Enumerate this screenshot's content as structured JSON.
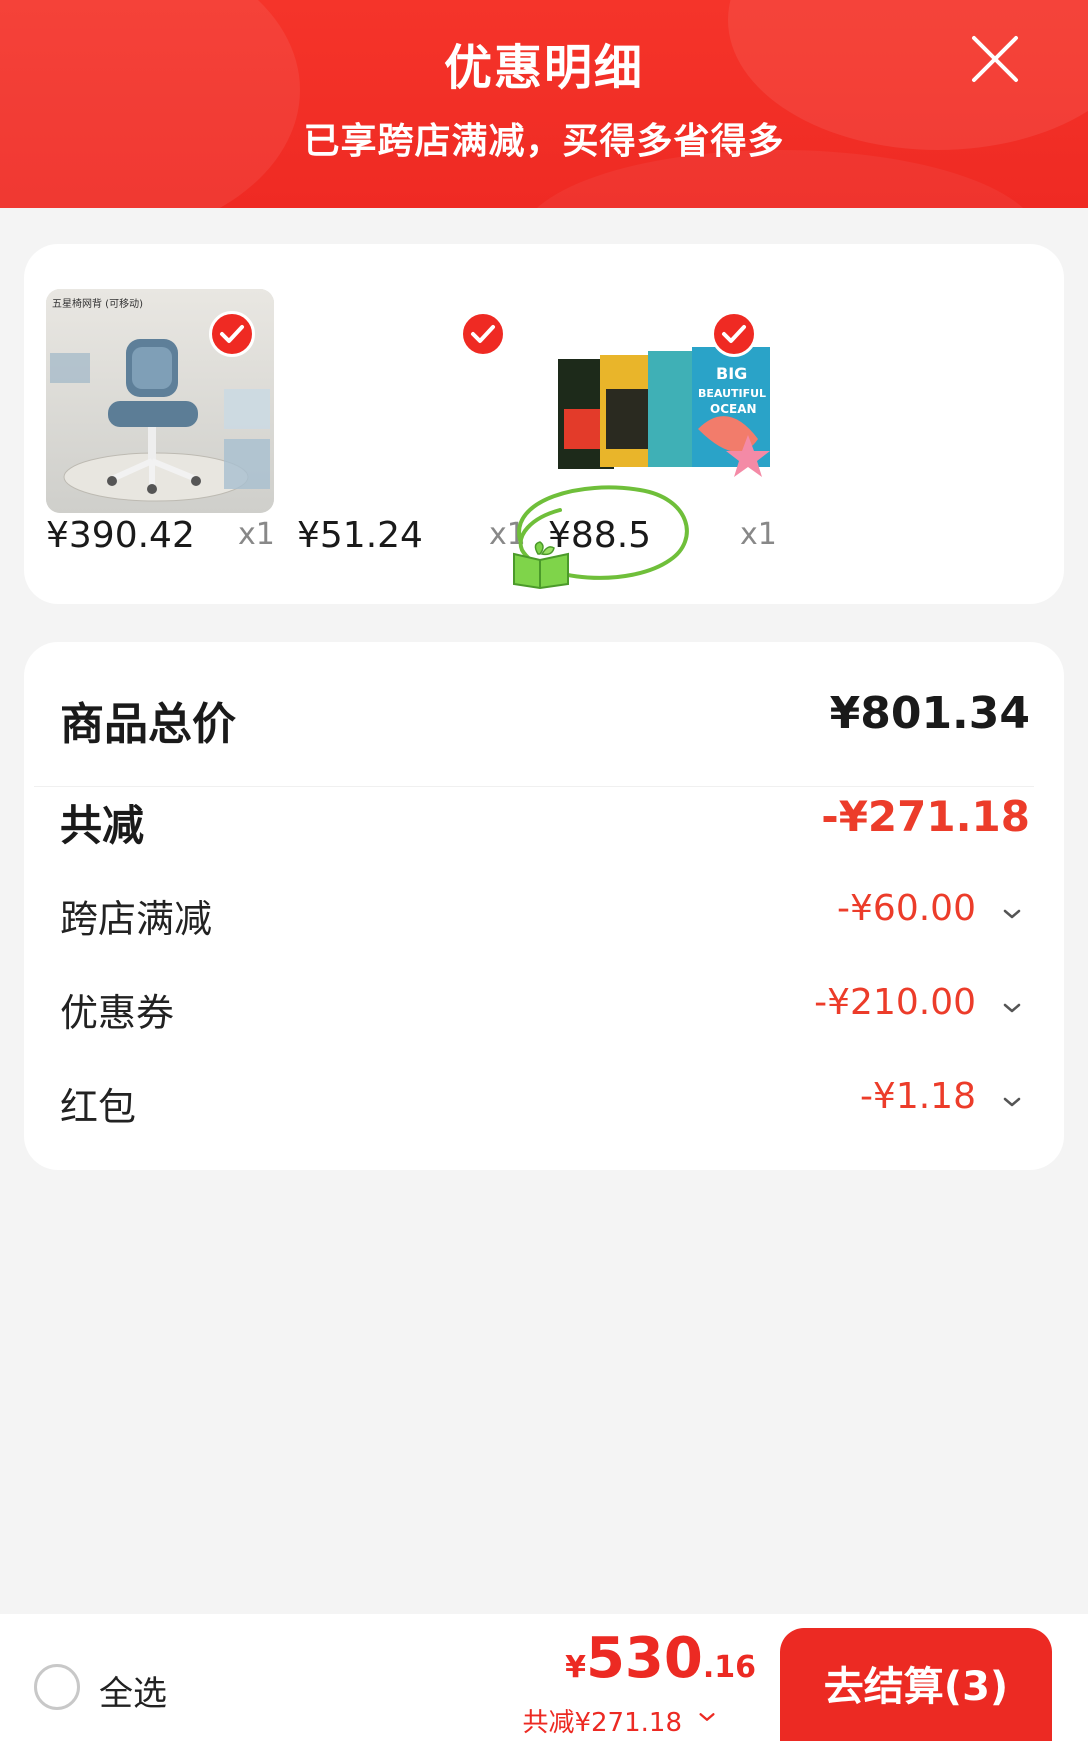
{
  "header": {
    "title": "优惠明细",
    "subtitle": "已享跨店满减，买得多省得多",
    "close_icon": "close-icon"
  },
  "products": [
    {
      "price": "¥390.42",
      "qty": "x1",
      "thumb_label": "五星椅网背 (可移动)",
      "selected": true
    },
    {
      "price": "¥51.24",
      "qty": "x1",
      "selected": true
    },
    {
      "price": "¥88.5",
      "qty": "x1",
      "selected": true,
      "book_titles": [
        "BIG",
        "BEAUTIFUL",
        "OCEAN"
      ]
    }
  ],
  "summary": {
    "total_label": "商品总价",
    "total_value": "¥801.34",
    "reduce_label": "共减",
    "reduce_value": "-¥271.18",
    "items": [
      {
        "label": "跨店满减",
        "value": "-¥60.00"
      },
      {
        "label": "优惠券",
        "value": "-¥210.00"
      },
      {
        "label": "红包",
        "value": "-¥1.18"
      }
    ]
  },
  "bottom_bar": {
    "select_all_label": "全选",
    "currency": "¥",
    "total_integer": "530",
    "total_decimal": ".16",
    "total_reduce": "共减¥271.18",
    "checkout_label": "去结算(3)"
  },
  "colors": {
    "brand_red": "#ef2a23",
    "price_red": "#ec3c2a",
    "background": "#f4f4f4"
  }
}
